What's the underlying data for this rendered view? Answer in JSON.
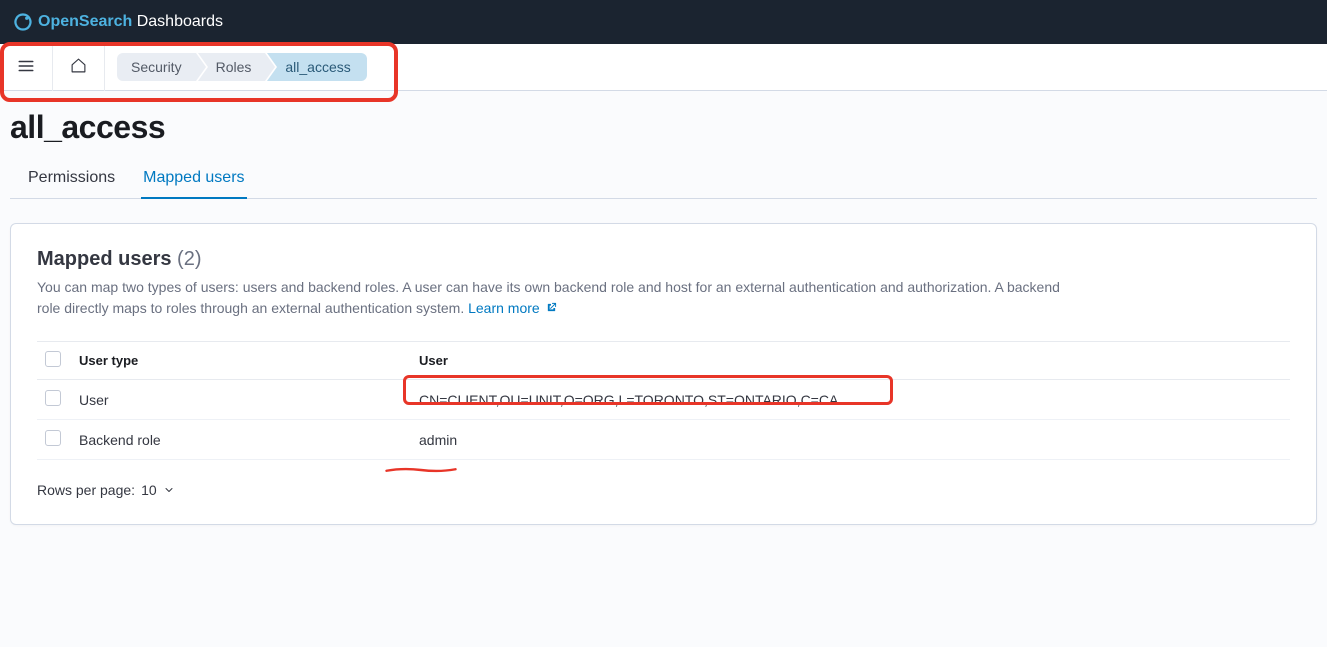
{
  "header": {
    "logo_open": "Open",
    "logo_search": "Search",
    "logo_dash": " Dashboards"
  },
  "breadcrumb": {
    "items": [
      {
        "label": "Security"
      },
      {
        "label": "Roles"
      },
      {
        "label": "all_access"
      }
    ]
  },
  "page": {
    "title": "all_access"
  },
  "tabs": [
    {
      "label": "Permissions"
    },
    {
      "label": "Mapped users"
    }
  ],
  "panel": {
    "title": "Mapped users",
    "count": "(2)",
    "description": "You can map two types of users: users and backend roles. A user can have its own backend role and host for an external authentication and authorization. A backend role directly maps to roles through an external authentication system. ",
    "learn_more": "Learn more"
  },
  "table": {
    "headers": {
      "usertype": "User type",
      "user": "User"
    },
    "rows": [
      {
        "usertype": "User",
        "user": "CN=CLIENT,OU=UNIT,O=ORG,L=TORONTO,ST=ONTARIO,C=CA"
      },
      {
        "usertype": "Backend role",
        "user": "admin"
      }
    ]
  },
  "pagination": {
    "rows_per_page_label": "Rows per page:",
    "rows_per_page_value": "10"
  }
}
